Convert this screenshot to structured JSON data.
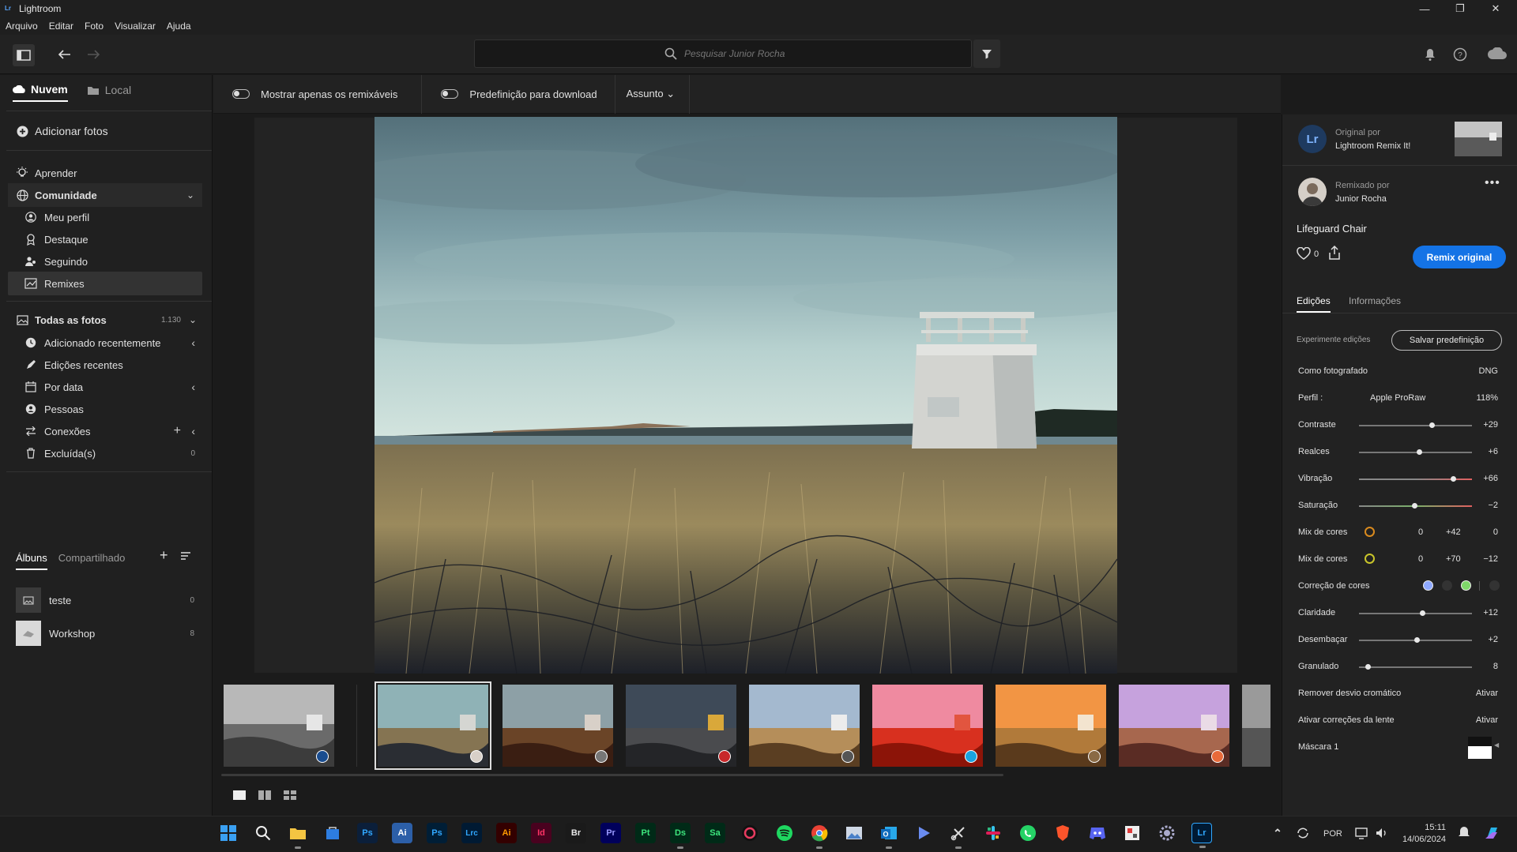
{
  "window": {
    "title": "Lightroom"
  },
  "menu": [
    "Arquivo",
    "Editar",
    "Foto",
    "Visualizar",
    "Ajuda"
  ],
  "search": {
    "placeholder": "Pesquisar Junior Rocha"
  },
  "nav": {
    "tabs": [
      "Nuvem",
      "Local"
    ],
    "add_photos": "Adicionar fotos",
    "learn": "Aprender",
    "community": "Comunidade",
    "community_items": [
      "Meu perfil",
      "Destaque",
      "Seguindo",
      "Remixes"
    ],
    "all_photos": "Todas as fotos",
    "all_photos_count": "1.130",
    "library_items": [
      "Adicionado recentemente",
      "Edições recentes",
      "Por data",
      "Pessoas",
      "Conexões",
      "Excluída(s)"
    ],
    "deleted_count": "0",
    "album_tabs": [
      "Álbuns",
      "Compartilhado"
    ],
    "albums": [
      {
        "name": "teste",
        "count": "0"
      },
      {
        "name": "Workshop",
        "count": "8"
      }
    ]
  },
  "filters": {
    "remixable_only": "Mostrar apenas os remixáveis",
    "download_preset": "Predefinição para download",
    "subject": "Assunto"
  },
  "details": {
    "original_label": "Original por",
    "original_author": "Lightroom Remix It!",
    "remixed_label": "Remixado por",
    "remixed_author": "Junior Rocha",
    "photo_title": "Lifeguard Chair",
    "likes": "0",
    "remix_button": "Remix original",
    "tabs": [
      "Edições",
      "Informações"
    ],
    "try_edits": "Experimente edições",
    "save_preset": "Salvar predefinição",
    "as_shot": "Como fotografado",
    "format": "DNG",
    "profile_label": "Perfil :",
    "profile_name": "Apple ProRaw",
    "profile_amount": "118%",
    "sliders": [
      {
        "label": "Contraste",
        "value": "+29",
        "pos": 0.64
      },
      {
        "label": "Realces",
        "value": "+6",
        "pos": 0.53
      },
      {
        "label": "Vibração",
        "value": "+66",
        "pos": 0.83
      },
      {
        "label": "Saturação",
        "value": "−2",
        "pos": 0.49
      }
    ],
    "color_mix": [
      {
        "label": "Mix de cores",
        "values": [
          "0",
          "+42",
          "0"
        ],
        "color": "#d98a1e"
      },
      {
        "label": "Mix de cores",
        "values": [
          "0",
          "+70",
          "−12"
        ],
        "color": "#c9c52a"
      }
    ],
    "color_correction": "Correção de cores",
    "sliders2": [
      {
        "label": "Claridade",
        "value": "+12",
        "pos": 0.56
      },
      {
        "label": "Desembaçar",
        "value": "+2",
        "pos": 0.51
      },
      {
        "label": "Granulado",
        "value": "8",
        "pos": 0.08
      }
    ],
    "chromatic": "Remover desvio cromático",
    "chromatic_action": "Ativar",
    "lens": "Ativar correções da lente",
    "lens_action": "Ativar",
    "mask": "Máscara 1"
  },
  "taskbar": {
    "time": "15:11",
    "date": "14/06/2024",
    "lang": "POR",
    "apps": [
      "Ps",
      "Ai",
      "Ps",
      "Lrc",
      "Ai",
      "Id",
      "Br",
      "Pr",
      "Pt",
      "Ds",
      "Sa",
      "Lr"
    ]
  }
}
